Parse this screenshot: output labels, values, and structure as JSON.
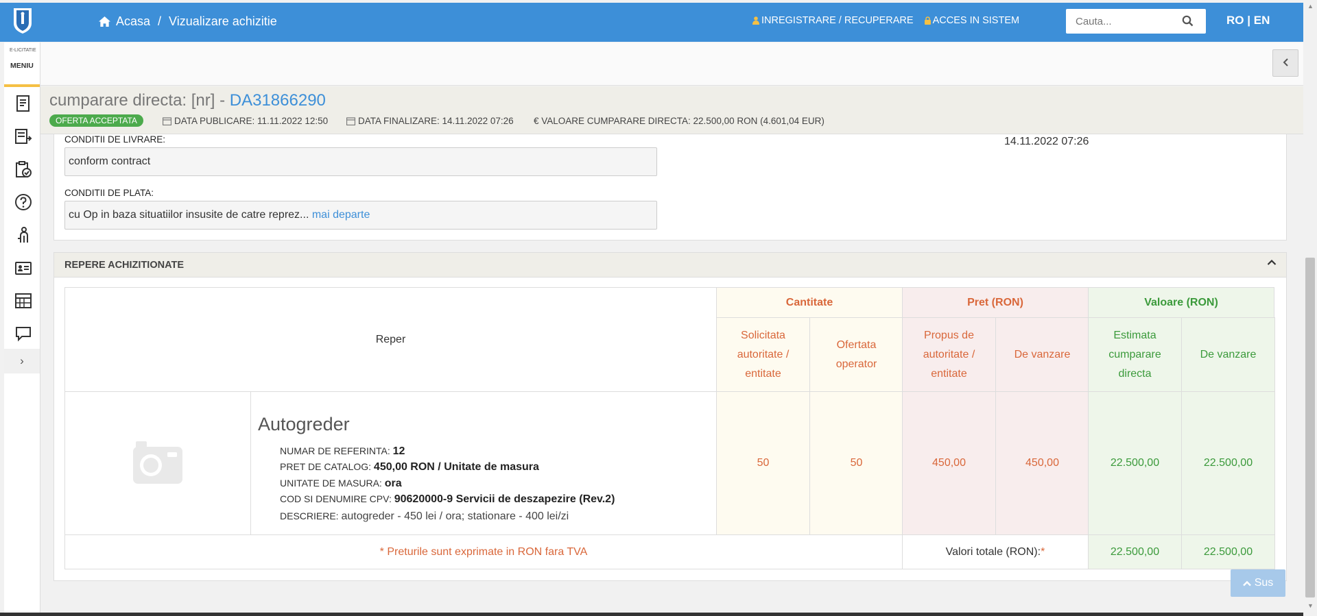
{
  "header": {
    "home_label": "Acasa",
    "separator": "/",
    "current_page": "Vizualizare achizitie",
    "register_link": "INREGISTRARE / RECUPERARE",
    "login_link": "ACCES IN SISTEM",
    "search_placeholder": "Cauta...",
    "lang_ro": "RO",
    "lang_sep": "|",
    "lang_en": "EN",
    "colors": {
      "topbar": "#3d8fd8"
    }
  },
  "sidebar": {
    "brand": "E-LICITATIE",
    "menu_label": "MENIU",
    "expand_glyph": "›",
    "icons": [
      "document-icon",
      "list-export-icon",
      "clipboard-check-icon",
      "help-icon",
      "person-icon",
      "id-card-icon",
      "calendar-grid-icon",
      "chat-icon"
    ]
  },
  "purchase": {
    "title_prefix": "cumparare directa: [nr] - ",
    "code": "DA31866290",
    "status_badge": "OFERTA ACCEPTATA",
    "published": "DATA PUBLICARE: 11.11.2022 12:50",
    "finalized": "DATA FINALIZARE: 14.11.2022 07:26",
    "value": "€ VALOARE CUMPARARE DIRECTA: 22.500,00  RON (4.601,04  EUR)"
  },
  "conditions": {
    "delivery_label": "CONDITII DE LIVRARE:",
    "delivery_value": "conform contract",
    "payment_label": "CONDITII DE PLATA:",
    "payment_value": "cu Op in baza situatiilor insusite de catre reprez...",
    "more_link": "mai departe",
    "date_value": "14.11.2022 07:26"
  },
  "repere": {
    "section_title": "REPERE ACHIZITIONATE",
    "col_reper": "Reper",
    "group_cantitate": "Cantitate",
    "group_pret": "Pret (RON)",
    "group_valoare": "Valoare (RON)",
    "sub_solicitata": "Solicitata autoritate / entitate",
    "sub_ofertata": "Ofertata operator",
    "sub_propus": "Propus de autoritate / entitate",
    "sub_pret_vanzare": "De vanzare",
    "sub_estimata": "Estimata cumparare directa",
    "sub_val_vanzare": "De vanzare",
    "item": {
      "name": "Autogreder",
      "ref_label": "NUMAR DE REFERINTA: ",
      "ref_value": "12",
      "catalog_label": "PRET DE CATALOG: ",
      "catalog_value": "450,00  RON / Unitate de masura",
      "unit_label": "UNITATE DE MASURA: ",
      "unit_value": "ora",
      "cpv_label": "COD SI DENUMIRE CPV: ",
      "cpv_value": "90620000-9 Servicii de deszapezire (Rev.2)",
      "desc_label": "DESCRIERE: ",
      "desc_value": "autogreder - 450 lei / ora; stationare - 400 lei/zi",
      "qty_requested": "50",
      "qty_offered": "50",
      "price_proposed": "450,00",
      "price_sale": "450,00",
      "value_estimated": "22.500,00",
      "value_sale": "22.500,00"
    },
    "footer_note": "* Preturile sunt exprimate in RON fara TVA",
    "totals_label": "Valori totale (RON): ",
    "totals_star": "*",
    "total_estimated": "22.500,00",
    "total_sale": "22.500,00"
  },
  "back_to_top": "Sus"
}
